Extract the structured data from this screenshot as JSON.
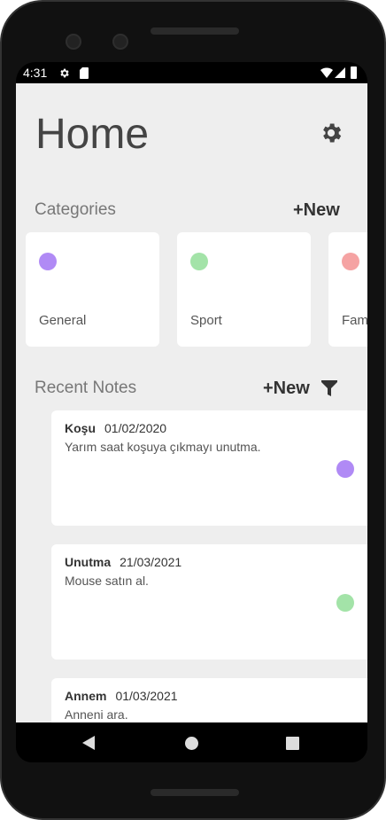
{
  "status_bar": {
    "time": "4:31"
  },
  "header": {
    "title": "Home"
  },
  "categories": {
    "label": "Categories",
    "new_label": "+New",
    "items": [
      {
        "name": "General",
        "color": "#b08af5"
      },
      {
        "name": "Sport",
        "color": "#a3e3a8"
      },
      {
        "name": "Family",
        "color": "#f5a3a3"
      }
    ]
  },
  "notes": {
    "label": "Recent Notes",
    "new_label": "+New",
    "items": [
      {
        "title": "Koşu",
        "date": "01/02/2020",
        "body": "Yarım saat koşuya çıkmayı unutma.",
        "color": "#b08af5"
      },
      {
        "title": "Unutma",
        "date": "21/03/2021",
        "body": "Mouse satın al.",
        "color": "#a3e3a8"
      },
      {
        "title": "Annem",
        "date": "01/03/2021",
        "body": "Anneni ara.",
        "color": ""
      }
    ]
  }
}
